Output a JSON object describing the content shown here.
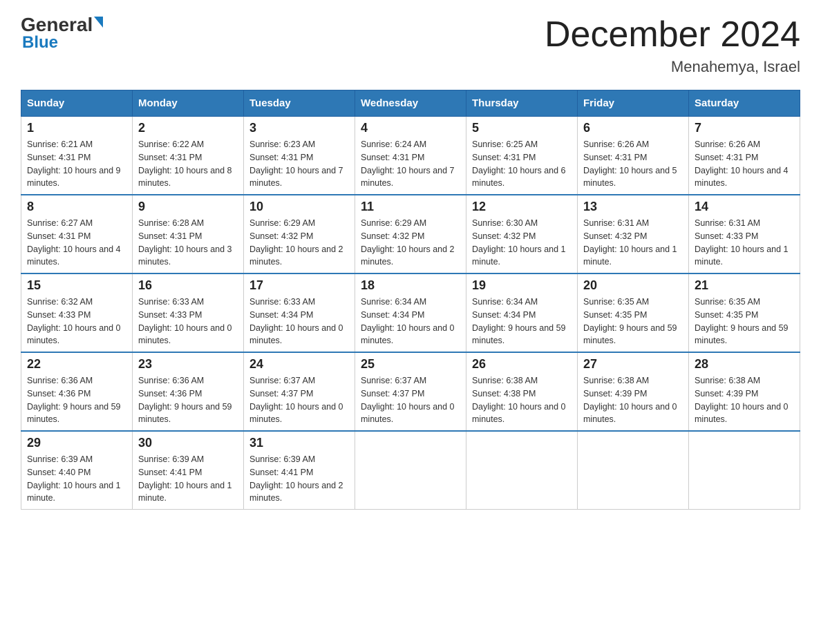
{
  "header": {
    "logo_general": "General",
    "logo_blue": "Blue",
    "month_title": "December 2024",
    "location": "Menahemya, Israel"
  },
  "days_of_week": [
    "Sunday",
    "Monday",
    "Tuesday",
    "Wednesday",
    "Thursday",
    "Friday",
    "Saturday"
  ],
  "weeks": [
    [
      {
        "day": "1",
        "sunrise": "6:21 AM",
        "sunset": "4:31 PM",
        "daylight": "10 hours and 9 minutes."
      },
      {
        "day": "2",
        "sunrise": "6:22 AM",
        "sunset": "4:31 PM",
        "daylight": "10 hours and 8 minutes."
      },
      {
        "day": "3",
        "sunrise": "6:23 AM",
        "sunset": "4:31 PM",
        "daylight": "10 hours and 7 minutes."
      },
      {
        "day": "4",
        "sunrise": "6:24 AM",
        "sunset": "4:31 PM",
        "daylight": "10 hours and 7 minutes."
      },
      {
        "day": "5",
        "sunrise": "6:25 AM",
        "sunset": "4:31 PM",
        "daylight": "10 hours and 6 minutes."
      },
      {
        "day": "6",
        "sunrise": "6:26 AM",
        "sunset": "4:31 PM",
        "daylight": "10 hours and 5 minutes."
      },
      {
        "day": "7",
        "sunrise": "6:26 AM",
        "sunset": "4:31 PM",
        "daylight": "10 hours and 4 minutes."
      }
    ],
    [
      {
        "day": "8",
        "sunrise": "6:27 AM",
        "sunset": "4:31 PM",
        "daylight": "10 hours and 4 minutes."
      },
      {
        "day": "9",
        "sunrise": "6:28 AM",
        "sunset": "4:31 PM",
        "daylight": "10 hours and 3 minutes."
      },
      {
        "day": "10",
        "sunrise": "6:29 AM",
        "sunset": "4:32 PM",
        "daylight": "10 hours and 2 minutes."
      },
      {
        "day": "11",
        "sunrise": "6:29 AM",
        "sunset": "4:32 PM",
        "daylight": "10 hours and 2 minutes."
      },
      {
        "day": "12",
        "sunrise": "6:30 AM",
        "sunset": "4:32 PM",
        "daylight": "10 hours and 1 minute."
      },
      {
        "day": "13",
        "sunrise": "6:31 AM",
        "sunset": "4:32 PM",
        "daylight": "10 hours and 1 minute."
      },
      {
        "day": "14",
        "sunrise": "6:31 AM",
        "sunset": "4:33 PM",
        "daylight": "10 hours and 1 minute."
      }
    ],
    [
      {
        "day": "15",
        "sunrise": "6:32 AM",
        "sunset": "4:33 PM",
        "daylight": "10 hours and 0 minutes."
      },
      {
        "day": "16",
        "sunrise": "6:33 AM",
        "sunset": "4:33 PM",
        "daylight": "10 hours and 0 minutes."
      },
      {
        "day": "17",
        "sunrise": "6:33 AM",
        "sunset": "4:34 PM",
        "daylight": "10 hours and 0 minutes."
      },
      {
        "day": "18",
        "sunrise": "6:34 AM",
        "sunset": "4:34 PM",
        "daylight": "10 hours and 0 minutes."
      },
      {
        "day": "19",
        "sunrise": "6:34 AM",
        "sunset": "4:34 PM",
        "daylight": "9 hours and 59 minutes."
      },
      {
        "day": "20",
        "sunrise": "6:35 AM",
        "sunset": "4:35 PM",
        "daylight": "9 hours and 59 minutes."
      },
      {
        "day": "21",
        "sunrise": "6:35 AM",
        "sunset": "4:35 PM",
        "daylight": "9 hours and 59 minutes."
      }
    ],
    [
      {
        "day": "22",
        "sunrise": "6:36 AM",
        "sunset": "4:36 PM",
        "daylight": "9 hours and 59 minutes."
      },
      {
        "day": "23",
        "sunrise": "6:36 AM",
        "sunset": "4:36 PM",
        "daylight": "9 hours and 59 minutes."
      },
      {
        "day": "24",
        "sunrise": "6:37 AM",
        "sunset": "4:37 PM",
        "daylight": "10 hours and 0 minutes."
      },
      {
        "day": "25",
        "sunrise": "6:37 AM",
        "sunset": "4:37 PM",
        "daylight": "10 hours and 0 minutes."
      },
      {
        "day": "26",
        "sunrise": "6:38 AM",
        "sunset": "4:38 PM",
        "daylight": "10 hours and 0 minutes."
      },
      {
        "day": "27",
        "sunrise": "6:38 AM",
        "sunset": "4:39 PM",
        "daylight": "10 hours and 0 minutes."
      },
      {
        "day": "28",
        "sunrise": "6:38 AM",
        "sunset": "4:39 PM",
        "daylight": "10 hours and 0 minutes."
      }
    ],
    [
      {
        "day": "29",
        "sunrise": "6:39 AM",
        "sunset": "4:40 PM",
        "daylight": "10 hours and 1 minute."
      },
      {
        "day": "30",
        "sunrise": "6:39 AM",
        "sunset": "4:41 PM",
        "daylight": "10 hours and 1 minute."
      },
      {
        "day": "31",
        "sunrise": "6:39 AM",
        "sunset": "4:41 PM",
        "daylight": "10 hours and 2 minutes."
      },
      null,
      null,
      null,
      null
    ]
  ]
}
